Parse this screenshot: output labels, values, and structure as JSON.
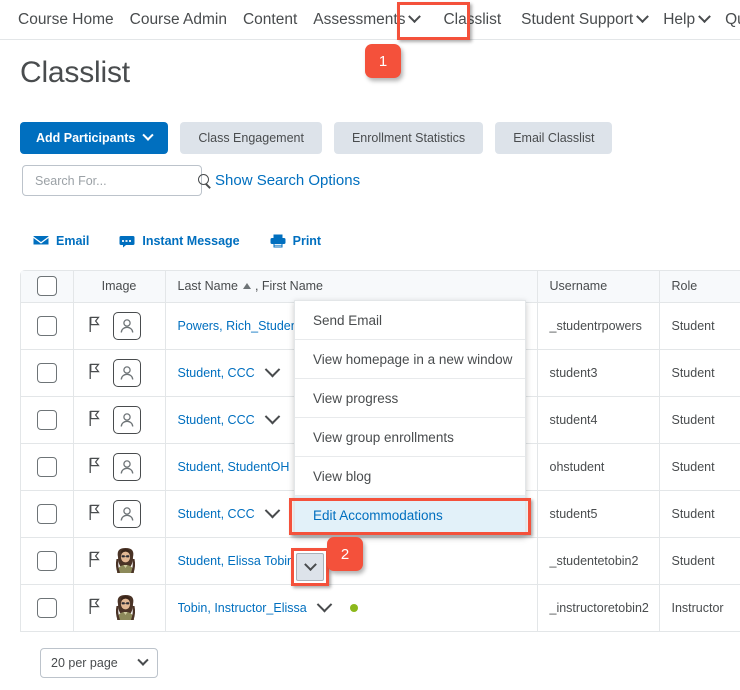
{
  "nav": {
    "items": [
      {
        "label": "Course Home",
        "has_caret": false,
        "highlighted": false
      },
      {
        "label": "Course Admin",
        "has_caret": false,
        "highlighted": false
      },
      {
        "label": "Content",
        "has_caret": false,
        "highlighted": false
      },
      {
        "label": "Assessments",
        "has_caret": true,
        "highlighted": false
      },
      {
        "label": "Classlist",
        "has_caret": false,
        "highlighted": true
      },
      {
        "label": "Student Support",
        "has_caret": true,
        "highlighted": false
      },
      {
        "label": "Help",
        "has_caret": true,
        "highlighted": false
      },
      {
        "label": "Quick Eval",
        "has_caret": false,
        "highlighted": false
      }
    ]
  },
  "badges": {
    "step1": "1",
    "step2": "2"
  },
  "page": {
    "title": "Classlist"
  },
  "toolbar": {
    "add_participants": "Add Participants",
    "class_engagement": "Class Engagement",
    "enrollment_statistics": "Enrollment Statistics",
    "email_classlist": "Email Classlist"
  },
  "search": {
    "value": "",
    "placeholder": "Search For...",
    "icon": "search-icon",
    "show_options_link": "Show Search Options"
  },
  "tools": [
    {
      "label": "Email",
      "icon": "envelope-icon"
    },
    {
      "label": "Instant Message",
      "icon": "chat-bubble-icon"
    },
    {
      "label": "Print",
      "icon": "printer-icon"
    }
  ],
  "table": {
    "headers": {
      "checkbox": "",
      "image": "Image",
      "name": "Last Name",
      "name_suffix": ", First Name",
      "sort": "ascending",
      "username": "Username",
      "role": "Role"
    },
    "rows": [
      {
        "name": "Powers, Rich_Student",
        "caret": false,
        "username": "_studentrpowers",
        "role": "Student",
        "avatar": "placeholder",
        "online": false
      },
      {
        "name": "Student, CCC",
        "caret": true,
        "username": "student3",
        "role": "Student",
        "avatar": "placeholder",
        "online": false
      },
      {
        "name": "Student, CCC",
        "caret": true,
        "username": "student4",
        "role": "Student",
        "avatar": "placeholder",
        "online": false
      },
      {
        "name": "Student, StudentOH",
        "caret": false,
        "username": "ohstudent",
        "role": "Student",
        "avatar": "placeholder",
        "online": false
      },
      {
        "name": "Student, CCC",
        "caret": true,
        "username": "student5",
        "role": "Student",
        "avatar": "placeholder",
        "online": false
      },
      {
        "name": "Student, Elissa Tobin",
        "caret": false,
        "username": "_studentetobin2",
        "role": "Student",
        "avatar": "photo",
        "online": false
      },
      {
        "name": "Tobin, Instructor_Elissa",
        "caret": true,
        "username": "_instructoretobin2",
        "role": "Instructor",
        "avatar": "photo",
        "online": true
      }
    ]
  },
  "context_menu": {
    "items": [
      {
        "label": "Send Email",
        "highlighted": false
      },
      {
        "label": "View homepage in a new window",
        "highlighted": false
      },
      {
        "label": "View progress",
        "highlighted": false
      },
      {
        "label": "View group enrollments",
        "highlighted": false
      },
      {
        "label": "View blog",
        "highlighted": false
      },
      {
        "label": "Edit Accommodations",
        "highlighted": true
      }
    ]
  },
  "pager": {
    "label": "20 per page"
  },
  "colors": {
    "primary_blue": "#006fbf",
    "link_blue": "#006fbf",
    "annotation_red": "#f4513b",
    "button_gray": "#dde3ea",
    "highlight_bg": "#e2f1f9",
    "online_green": "#8cb81b",
    "text": "#494c4e"
  }
}
